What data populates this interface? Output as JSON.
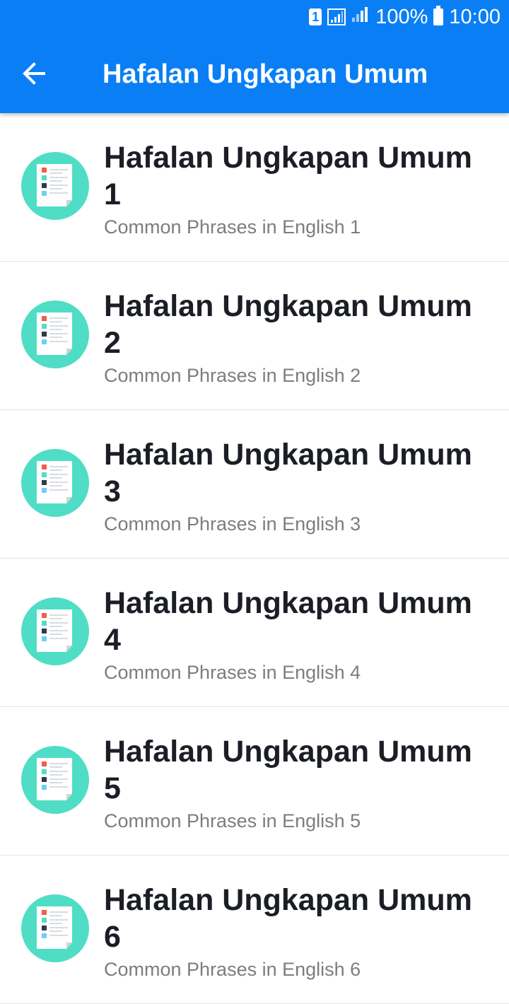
{
  "status_bar": {
    "sim_label": "1",
    "battery": "100%",
    "time": "10:00",
    "icons": [
      "sim-icon",
      "signal-icon",
      "signal-icon",
      "battery-icon"
    ]
  },
  "app_bar": {
    "title": "Hafalan Ungkapan Umum",
    "back_icon": "arrow-left-icon",
    "color": "#0a7ff5"
  },
  "list": {
    "icon": "document-list-icon",
    "icon_bg": "#4fdec5",
    "items": [
      {
        "title": "Hafalan Ungkapan Umum 1",
        "subtitle": "Common Phrases in English 1"
      },
      {
        "title": "Hafalan Ungkapan Umum 2",
        "subtitle": "Common Phrases in English 2"
      },
      {
        "title": "Hafalan Ungkapan Umum 3",
        "subtitle": "Common Phrases in English 3"
      },
      {
        "title": "Hafalan Ungkapan Umum 4",
        "subtitle": "Common Phrases in English 4"
      },
      {
        "title": "Hafalan Ungkapan Umum 5",
        "subtitle": "Common Phrases in English 5"
      },
      {
        "title": "Hafalan Ungkapan Umum 6",
        "subtitle": "Common Phrases in English 6"
      }
    ]
  }
}
